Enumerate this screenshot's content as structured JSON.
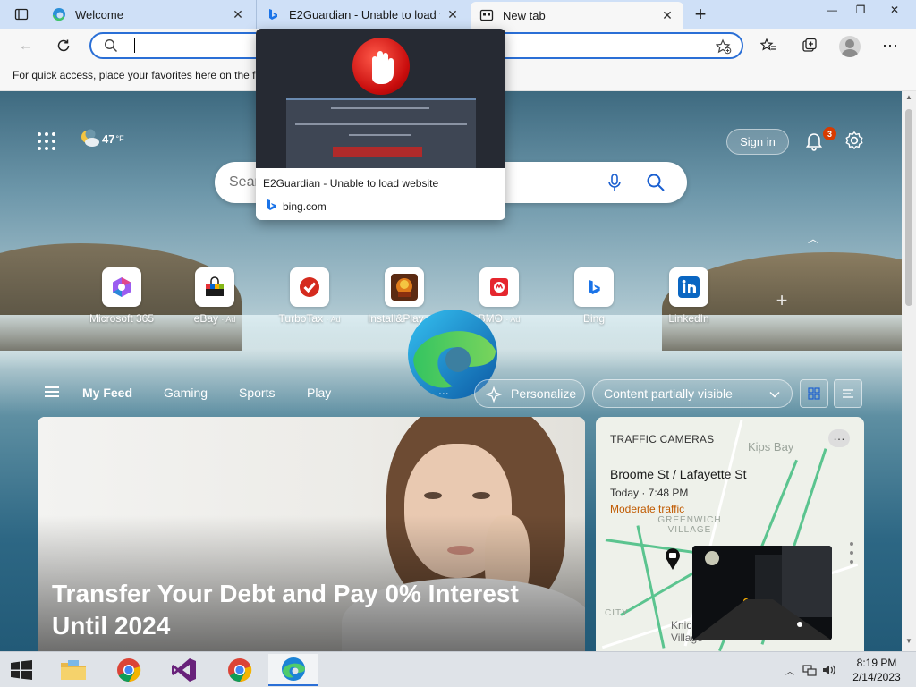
{
  "browser": {
    "tabs": [
      {
        "title": "Welcome",
        "icon": "edge-icon"
      },
      {
        "title": "E2Guardian - Unable to load website",
        "icon": "bing-icon"
      },
      {
        "title": "New tab",
        "icon": "new-tab-page-icon",
        "active": true
      }
    ],
    "window_controls": {
      "minimize": "—",
      "restore": "❐",
      "close": "✕"
    }
  },
  "toolbar": {
    "address_value": "",
    "address_placeholder": ""
  },
  "favorites_bar": {
    "message": "For quick access, place your favorites here on the favorites bar."
  },
  "tab_preview": {
    "title": "E2Guardian - Unable to load website",
    "host": "bing.com"
  },
  "ntp": {
    "weather": {
      "temp": "47",
      "unit": "°F"
    },
    "signin_label": "Sign in",
    "notification_count": "3",
    "search_placeholder": "Search the web",
    "quick_links": [
      {
        "label": "Microsoft 365",
        "ad": "",
        "icon": "microsoft-365-icon"
      },
      {
        "label": "eBay",
        "ad": "· Ad",
        "icon": "ebay-icon"
      },
      {
        "label": "TurboTax",
        "ad": "· Ad",
        "icon": "turbotax-icon"
      },
      {
        "label": "Install&Play",
        "ad": "· Ad",
        "icon": "install-play-icon"
      },
      {
        "label": "BMO",
        "ad": "· Ad",
        "icon": "bmo-icon"
      },
      {
        "label": "Bing",
        "ad": "",
        "icon": "bing-icon"
      },
      {
        "label": "LinkedIn",
        "ad": "",
        "icon": "linkedin-icon"
      }
    ],
    "feed_tabs": [
      "My Feed",
      "Gaming",
      "Sports",
      "Play"
    ],
    "feed_more": "...",
    "personalize_label": "Personalize",
    "content_visibility": "Content partially visible",
    "hero_card": {
      "headline": "Transfer Your Debt and Pay 0% Interest Until 2024"
    },
    "traffic_card": {
      "title": "TRAFFIC CAMERAS",
      "location": "Broome St / Lafayette St",
      "time": "Today · 7:48 PM",
      "condition": "Moderate traffic",
      "map_labels": [
        "Kips Bay",
        "GREENWICH VILLAGE",
        "Knickerbocker Village",
        "CITY"
      ]
    }
  },
  "taskbar": {
    "apps": [
      "file-explorer-icon",
      "chrome-icon",
      "visual-studio-icon",
      "chrome-icon",
      "edge-icon"
    ],
    "time": "8:19 PM",
    "date": "2/14/2023"
  },
  "colors": {
    "accent": "#2a6fd6",
    "tabbar_bg": "#cfe0f7",
    "traffic_moderate": "#c05a00",
    "notification_badge": "#d83b01"
  }
}
